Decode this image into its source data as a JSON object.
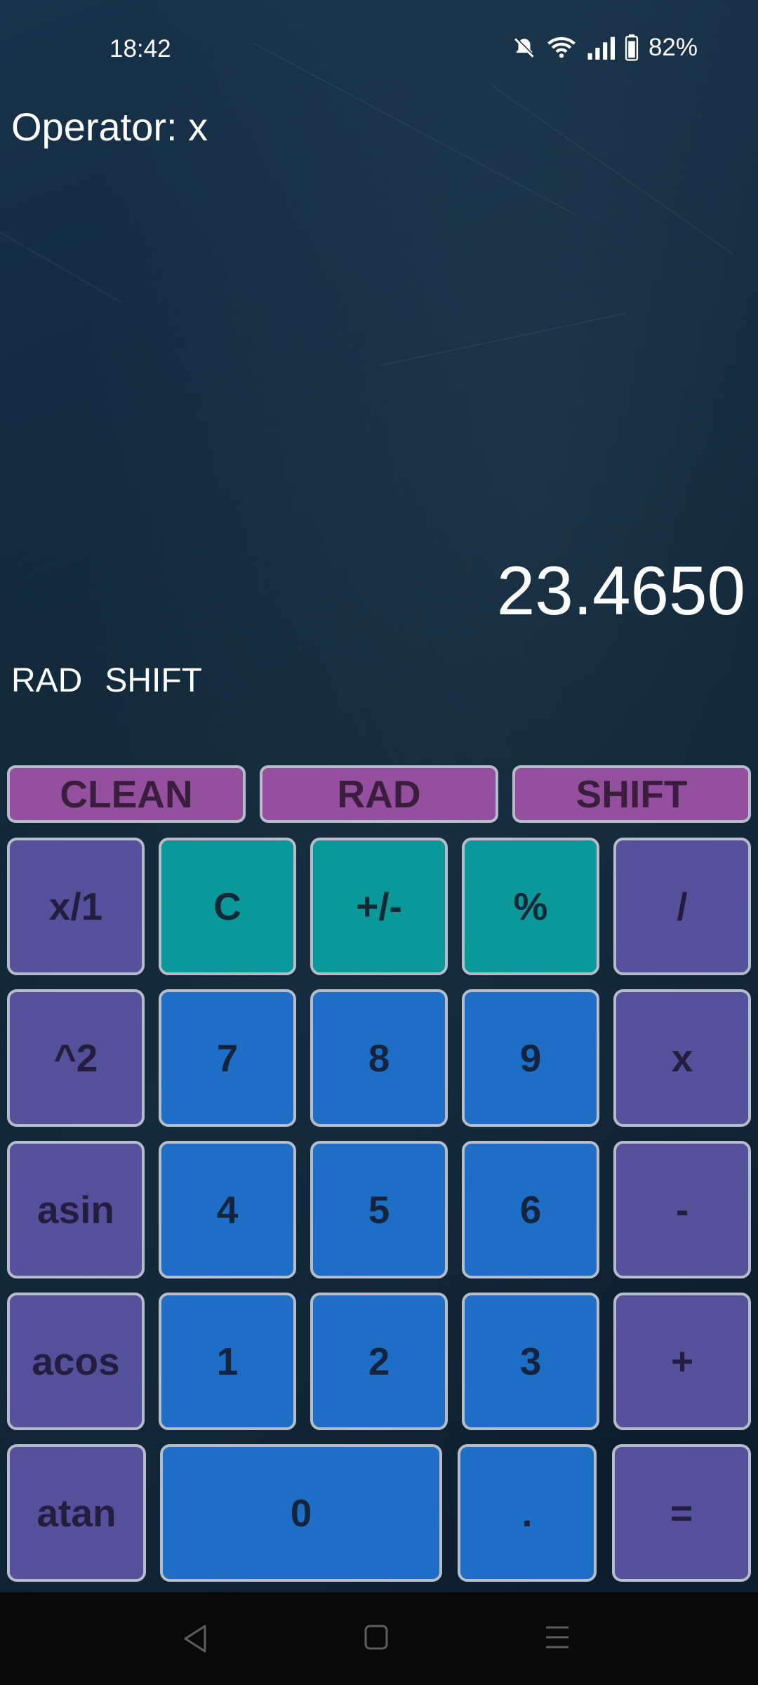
{
  "status": {
    "time": "18:42",
    "battery": "82%",
    "icons": [
      "bell-muted-icon",
      "wifi-icon",
      "signal-icon",
      "battery-icon"
    ]
  },
  "calculator": {
    "operator_text": "Operator: x",
    "display_value": "23.4650",
    "angle_mode": "RAD",
    "shift_indicator": "SHIFT"
  },
  "top_buttons": {
    "clean": "CLEAN",
    "rad": "RAD",
    "shift": "SHIFT"
  },
  "keys": {
    "reciprocal": "x/1",
    "clear": "C",
    "negate": "+/-",
    "percent": "%",
    "divide": "/",
    "square": "^2",
    "seven": "7",
    "eight": "8",
    "nine": "9",
    "multiply": "x",
    "asin": "asin",
    "four": "4",
    "five": "5",
    "six": "6",
    "minus": "-",
    "acos": "acos",
    "one": "1",
    "two": "2",
    "three": "3",
    "plus": "+",
    "atan": "atan",
    "zero": "0",
    "decimal": ".",
    "equals": "="
  },
  "colors": {
    "top_button": "#94509f",
    "function_key": "#55509a",
    "teal_key": "#0b9899",
    "number_key": "#1d6fc5",
    "background": "#0f2233"
  },
  "navbar_icons": [
    "back-icon",
    "home-icon",
    "menu-icon"
  ]
}
